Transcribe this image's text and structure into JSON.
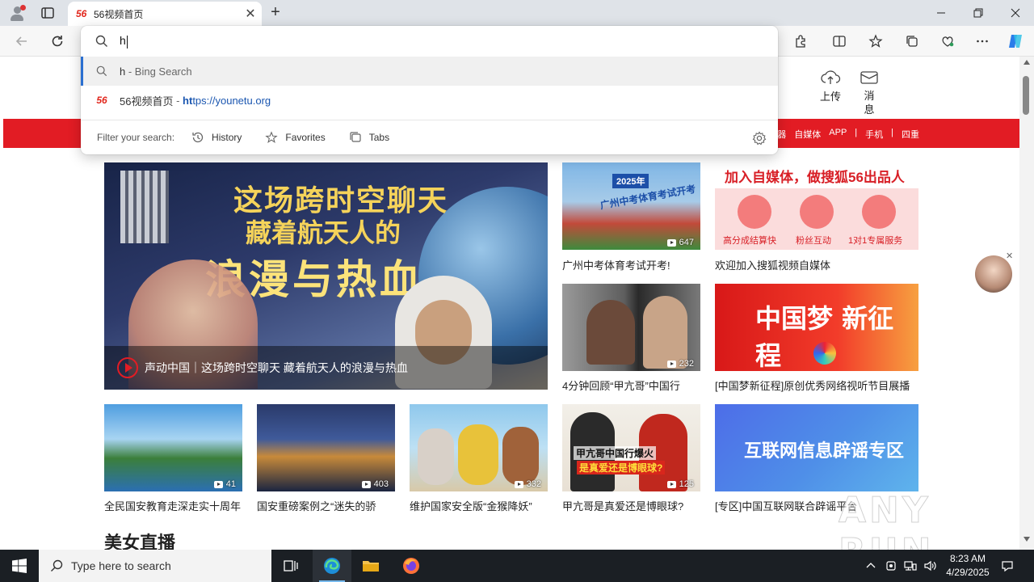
{
  "browser": {
    "tab_title": "56视频首页",
    "tab_favicon": "56",
    "new_tab_label": "+",
    "address_typed": "h"
  },
  "omnibox": {
    "suggestions": [
      {
        "query": "h",
        "suffix": " - Bing Search",
        "icon": "search-icon"
      },
      {
        "site_icon": "56",
        "title": "56视频首页",
        "dash": " - ",
        "url_bold": "ht",
        "url_rest": "tps://younetu.org"
      }
    ],
    "filter_label": "Filter your search:",
    "filters": [
      "History",
      "Favorites",
      "Tabs"
    ]
  },
  "site": {
    "upload_label": "上传",
    "message_label": "消息",
    "nav_links": [
      "播放器",
      "自媒体",
      "APP",
      "|",
      "手机",
      "|",
      "四重"
    ],
    "hero": {
      "line1": "这场跨时空聊天",
      "line2": "藏着航天人的",
      "line3": "浪漫与热血",
      "caption": "声动中国｜这场跨时空聊天 藏着航天人的浪漫与热血"
    },
    "videos": [
      {
        "title": "广州中考体育考试开考!",
        "count": "647"
      },
      {
        "title": "4分钟回顾“甲亢哥”中国行",
        "count": "232"
      },
      {
        "title": "全民国安教育走深走实十周年",
        "count": "41"
      },
      {
        "title": "国安重磅案例之“迷失的骄",
        "count": "403"
      },
      {
        "title": "维护国家安全版“金猴降妖”",
        "count": "332"
      },
      {
        "title": "甲亢哥是真爱还是博眼球?",
        "count": "125"
      }
    ],
    "thumb_texts": {
      "exam_year": "2025年",
      "exam_title": "广州中考体育考试开考",
      "ishowspeed": "甲亢哥中国行爆火",
      "ishowspeed_sub": "是真爱还是博眼球?"
    },
    "ads": [
      {
        "title": "欢迎加入搜狐视频自媒体",
        "banner": "加入自媒体，做搜狐56出品人",
        "items": [
          "高分成结算快",
          "粉丝互动",
          "1对1专属服务"
        ]
      },
      {
        "title": "[中国梦新征程]原创优秀网络视听节目展播",
        "banner": "中国梦 新征程"
      },
      {
        "title": "[专区]中国互联网联合辟谣平台",
        "banner": "互联网信息辟谣专区"
      }
    ],
    "section_title": "美女直播",
    "watermark": "ANY RUN"
  },
  "taskbar": {
    "search_placeholder": "Type here to search",
    "time": "8:23 AM",
    "date": "4/29/2025"
  }
}
